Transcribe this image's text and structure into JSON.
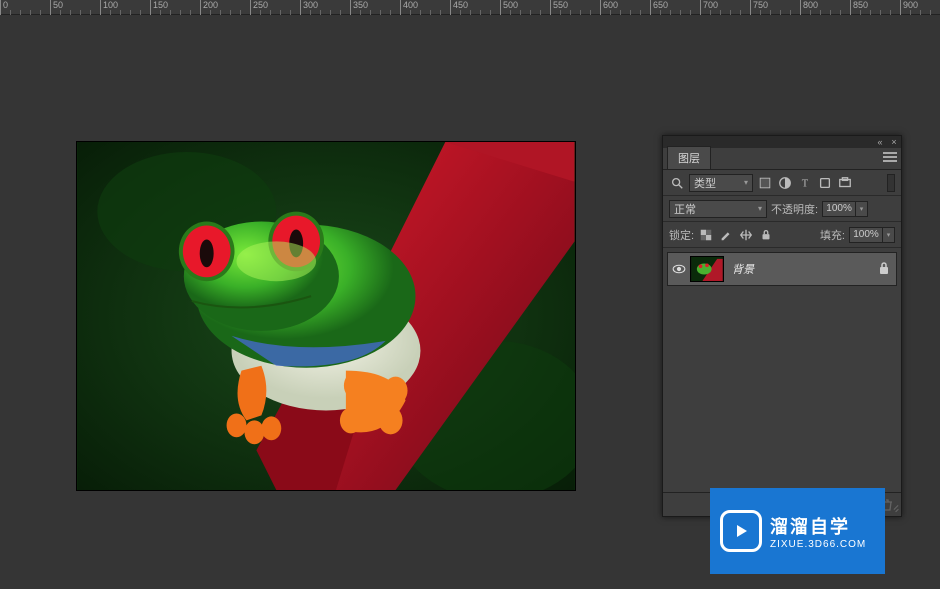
{
  "ruler": {
    "major_ticks": [
      0,
      50,
      100,
      150,
      200,
      250,
      300,
      350,
      400,
      450,
      500,
      550,
      600,
      650,
      700,
      750,
      800,
      850,
      900
    ]
  },
  "canvas": {
    "image_description": "red-eyed tree frog on red leaf"
  },
  "panel": {
    "tab_label": "图层",
    "kind_label": "类型",
    "blend_mode": "正常",
    "opacity_label": "不透明度:",
    "opacity_value": "100%",
    "lock_label": "锁定:",
    "fill_label": "填充:",
    "fill_value": "100%",
    "layer": {
      "name": "背景",
      "visible": true,
      "locked": true
    },
    "filter_icons": [
      "image",
      "adjust",
      "text",
      "shape",
      "smart"
    ]
  },
  "watermark": {
    "title": "溜溜自学",
    "sub": "ZIXUE.3D66.COM"
  }
}
